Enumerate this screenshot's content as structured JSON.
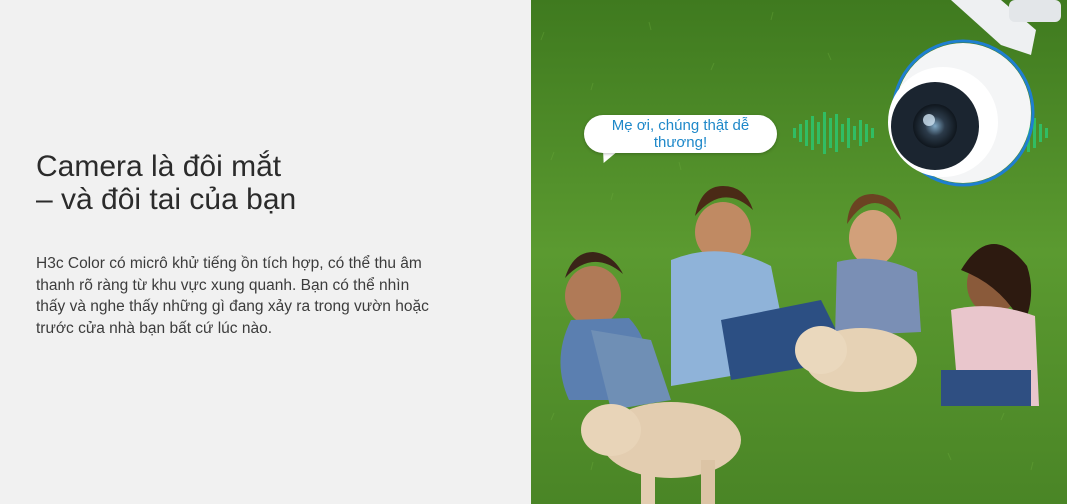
{
  "headline": {
    "line1": "Camera là đôi mắt",
    "line2": "– và đôi tai của bạn"
  },
  "description": "H3c Color có micrô khử tiếng ồn tích hợp, có thể thu âm thanh rõ ràng từ khu vực xung quanh. Bạn có thể nhìn thấy và nghe thấy những gì đang xảy ra trong vườn hoặc trước cửa nhà bạn bất cứ lúc nào.",
  "speech_bubble": {
    "text": "Mẹ ơi, chúng thật dễ thương!"
  },
  "colors": {
    "background": "#f1f1f1",
    "headline": "#2b2b2b",
    "body_text": "#3c3c3c",
    "bubble_text": "#1e88c9",
    "sound_wave": "#2ec36a",
    "grass": "#4f8a2a"
  },
  "images": {
    "photo": "children-with-puppies-on-grass",
    "device": "security-camera-icon",
    "audio": "sound-wave-icon"
  }
}
